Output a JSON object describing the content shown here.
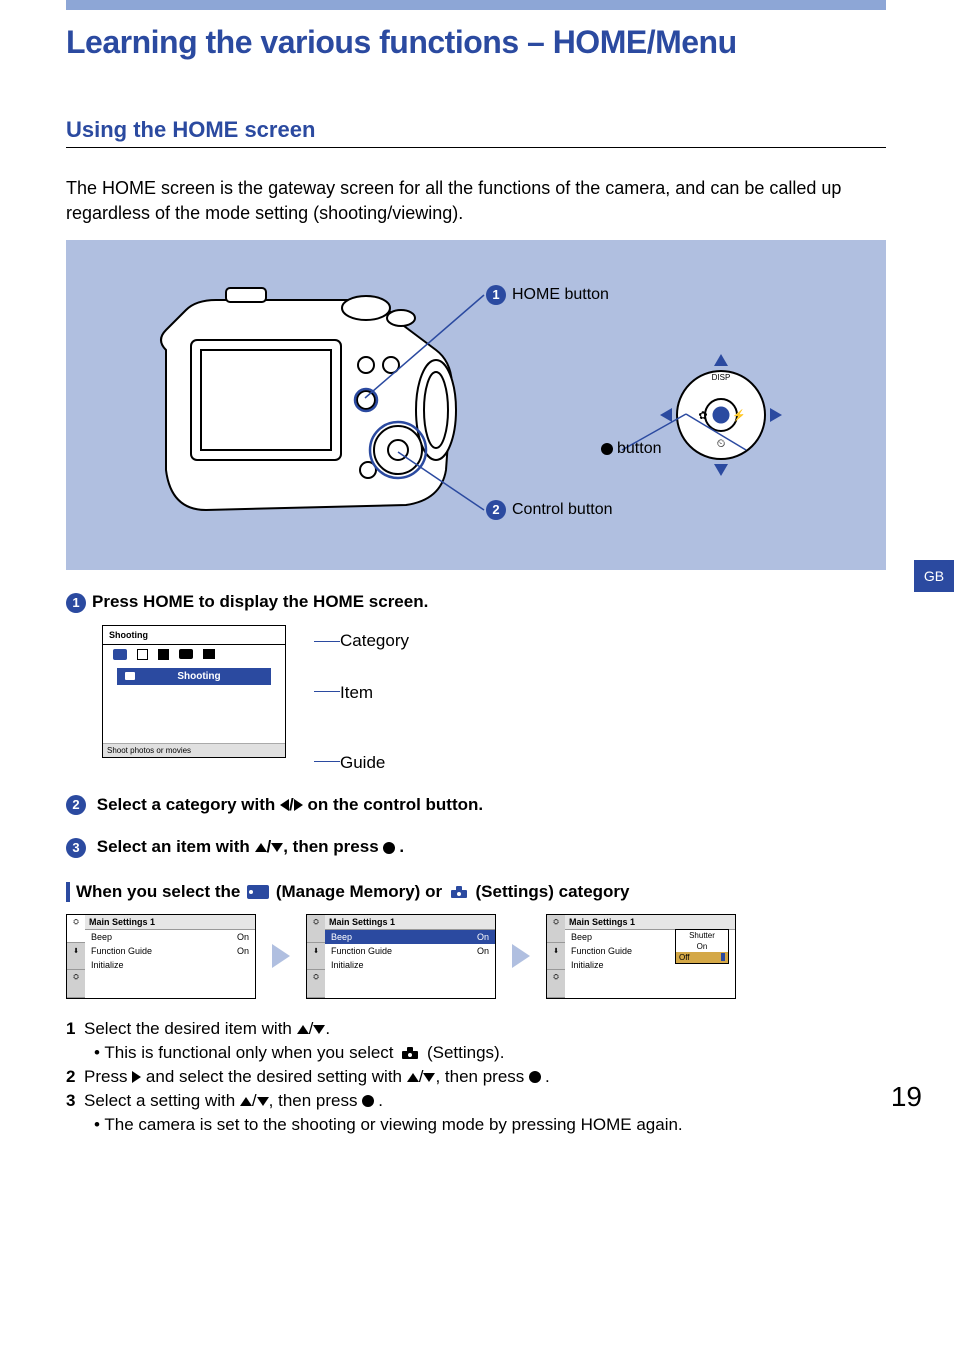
{
  "header": {
    "title": "Learning the various functions – HOME/Menu"
  },
  "sideTab": "GB",
  "section": {
    "title": "Using the HOME screen"
  },
  "intro": "The HOME screen is the gateway screen for all the functions of the camera, and can be called up regardless of the mode setting (shooting/viewing).",
  "diagram": {
    "callouts": {
      "home": "HOME button",
      "control": "Control button",
      "center": "button",
      "dpad_top": "DISP"
    }
  },
  "steps": {
    "s1": "Press HOME to display the HOME screen.",
    "s2_pre": "Select a category with ",
    "s2_post": " on the control button.",
    "s3_pre": "Select an item with ",
    "s3_mid": ", then press ",
    "s3_post": "."
  },
  "homeScreenMock": {
    "topLabel": "Shooting",
    "itemLabel": "Shooting",
    "guideText": "Shoot photos or movies",
    "annotations": {
      "category": "Category",
      "item": "Item",
      "guide": "Guide"
    }
  },
  "subheading": {
    "pre": "When you select the ",
    "mid1": " (Manage Memory) or ",
    "mid2": " (Settings) category"
  },
  "settingsScreens": {
    "header": "Main Settings 1",
    "rows": [
      {
        "label": "Beep",
        "value": "On"
      },
      {
        "label": "Function Guide",
        "value": "On"
      },
      {
        "label": "Initialize",
        "value": ""
      }
    ],
    "popup": {
      "title": "Shutter",
      "options": [
        "On",
        "Off"
      ]
    }
  },
  "numlist": {
    "i1_pre": "Select the desired item with ",
    "i1_post": ".",
    "i1_note_pre": "• This is functional only when you select ",
    "i1_note_post": " (Settings).",
    "i2_pre": "Press ",
    "i2_mid": " and select the desired setting with ",
    "i2_mid2": ", then press ",
    "i2_post": ".",
    "i3_pre": "Select a setting with ",
    "i3_mid": ", then press ",
    "i3_post": ".",
    "i3_note": "• The camera is set to the shooting or viewing mode by pressing HOME again."
  },
  "pageNumber": "19"
}
